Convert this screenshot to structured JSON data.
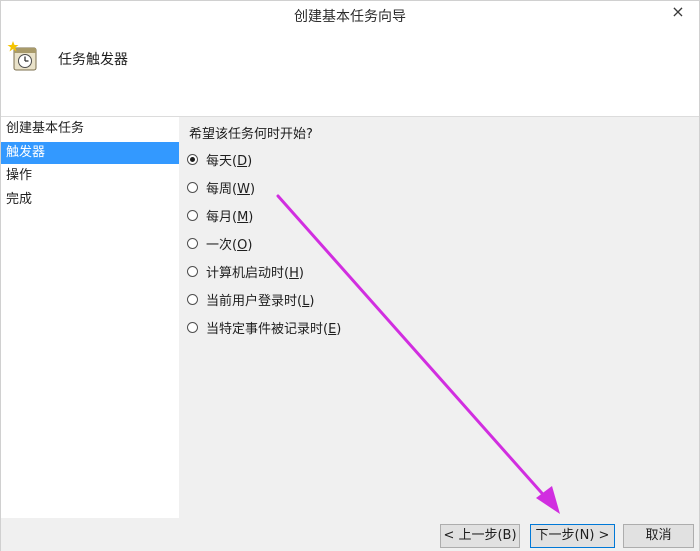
{
  "window": {
    "title": "创建基本任务向导",
    "close_glyph": "×"
  },
  "header": {
    "title": "任务触发器",
    "icon": "task-scheduler-clock-icon"
  },
  "sidebar": {
    "items": [
      {
        "label": "创建基本任务",
        "selected": false
      },
      {
        "label": "触发器",
        "selected": true
      },
      {
        "label": "操作",
        "selected": false
      },
      {
        "label": "完成",
        "selected": false
      }
    ]
  },
  "trigger": {
    "question": "希望该任务何时开始?",
    "options": [
      {
        "text": "每天(",
        "key": "D",
        "close": ")",
        "checked": true
      },
      {
        "text": "每周(",
        "key": "W",
        "close": ")",
        "checked": false
      },
      {
        "text": "每月(",
        "key": "M",
        "close": ")",
        "checked": false
      },
      {
        "text": "一次(",
        "key": "O",
        "close": ")",
        "checked": false
      },
      {
        "text": "计算机启动时(",
        "key": "H",
        "close": ")",
        "checked": false
      },
      {
        "text": "当前用户登录时(",
        "key": "L",
        "close": ")",
        "checked": false
      },
      {
        "text": "当特定事件被记录时(",
        "key": "E",
        "close": ")",
        "checked": false
      }
    ]
  },
  "footer": {
    "back_label": "< 上一步(B)",
    "next_label": "下一步(N) >",
    "cancel_label": "取消"
  },
  "colors": {
    "selection": "#3399ff",
    "annotation_arrow": "#d12ee0"
  }
}
